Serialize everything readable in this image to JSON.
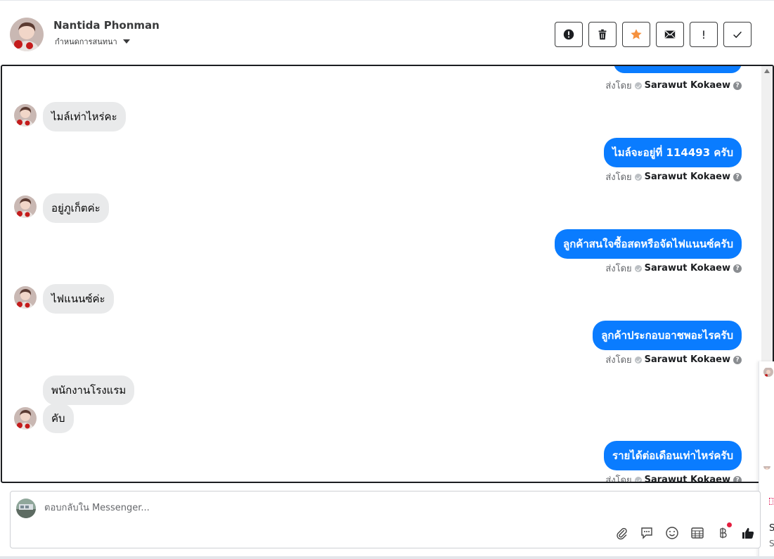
{
  "header": {
    "name": "Nantida Phonman",
    "subtitle": "กำหนดการสนทนา"
  },
  "toolbar": {
    "buttons": [
      {
        "icon": "alert-circle-icon"
      },
      {
        "icon": "trash-icon"
      },
      {
        "icon": "star-icon",
        "color": "#f5913e"
      },
      {
        "icon": "envelope-icon"
      },
      {
        "icon": "exclamation-icon",
        "label": "!"
      },
      {
        "icon": "check-icon"
      }
    ]
  },
  "conversation": {
    "sent_by_label": "ส่งโดย",
    "agent_name": "Sarawut Kokaew",
    "messages": [
      {
        "direction": "in",
        "text": "ไมล์เท่าไหร่คะ"
      },
      {
        "direction": "out",
        "text": "ไมล์จะอยู่ที่ 114493 ครับ"
      },
      {
        "direction": "in",
        "text": "อยู่ภูเก็ตค่ะ"
      },
      {
        "direction": "out",
        "text": "ลูกค้าสนใจซื้อสดหรือจัดไฟแนนซ์ครับ"
      },
      {
        "direction": "in",
        "text": "ไฟแนนซ์ค่ะ"
      },
      {
        "direction": "out",
        "text": "ลูกค้าประกอบอาชพอะไรครับ"
      },
      {
        "direction": "in",
        "text": "พนักงานโรงแรม"
      },
      {
        "direction": "in",
        "text": "คับ"
      },
      {
        "direction": "out",
        "text": "รายได้ต่อเดือนเท่าไหร่ครับ"
      }
    ]
  },
  "composer": {
    "placeholder": "ตอบกลับใน Messenger..."
  },
  "side_peek": {
    "initial_1": "S",
    "initial_2": "S"
  },
  "colors": {
    "outgoing_bubble": "#0a7cff",
    "incoming_bubble": "#e9eaeb",
    "star": "#f5913e"
  }
}
